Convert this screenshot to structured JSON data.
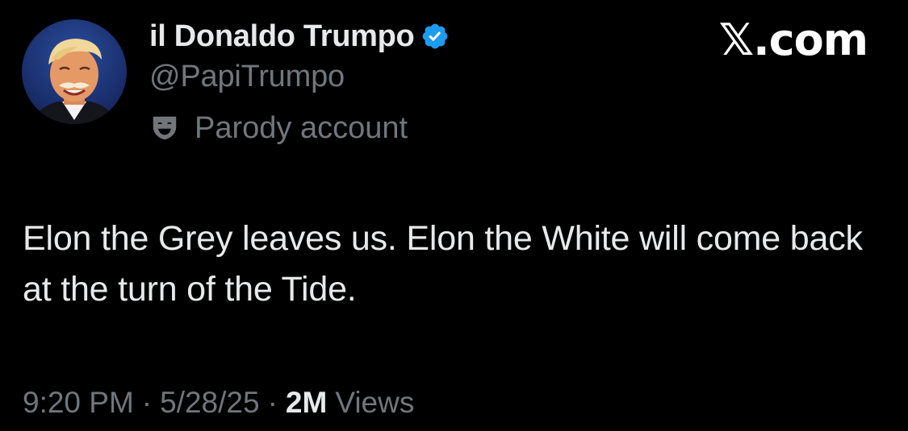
{
  "author": {
    "display_name": "il Donaldo Trumpo",
    "handle": "@PapiTrumpo",
    "verified": true,
    "label": "Parody account",
    "label_icon": "theater-masks-icon",
    "avatar_icon": "avatar-photo"
  },
  "brand": {
    "text": "𝕏.com"
  },
  "tweet": {
    "text": "Elon the Grey leaves us. Elon the White will come back at the turn of the Tide."
  },
  "meta": {
    "time": "9:20 PM",
    "separator": "·",
    "date": "5/28/25",
    "views_count": "2M",
    "views_label": "Views"
  },
  "colors": {
    "background": "#000000",
    "primary_text": "#e7e9ea",
    "secondary_text": "#71767b",
    "verified_blue": "#1d9bf0"
  }
}
